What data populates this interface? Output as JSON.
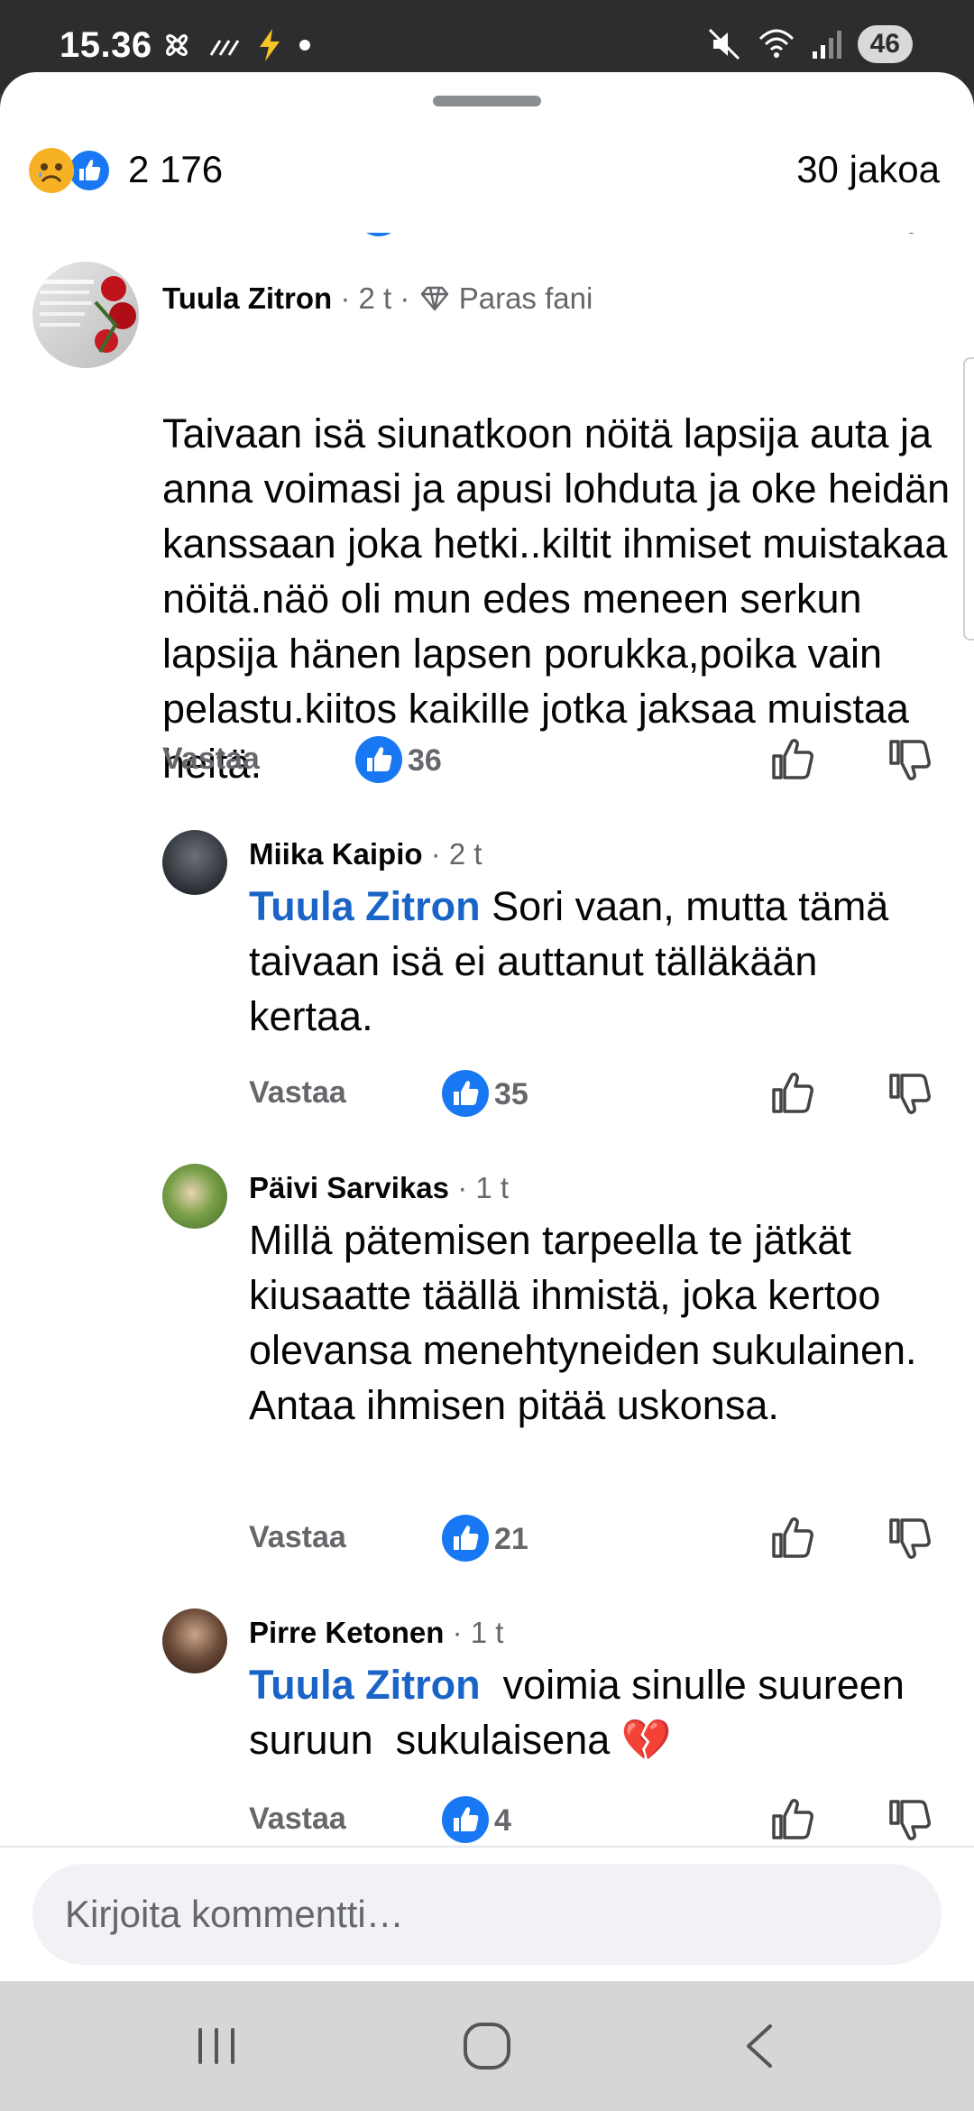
{
  "status_bar": {
    "time": "15.36",
    "battery": "46"
  },
  "reactions": {
    "count": "2 176",
    "shares": "30 jakoa"
  },
  "comments": [
    {
      "author": "Tuula Zitron",
      "time": "· 2 t ·",
      "badge": "Paras fani",
      "text": "Taivaan isä siunatkoon nöitä lapsija auta ja anna voimasi ja apusi lohduta ja oke heidän kanssaan joka hetki..kiltit ihmiset muistakaa nöitä.näö oli mun edes meneen serkun lapsija hänen lapsen porukka,poika vain pelastu.kiitos kaikille jotka jaksaa muistaa heitä.",
      "reply_label": "Vastaa",
      "likes": "36"
    },
    {
      "author": "Miika Kaipio",
      "time": "· 2 t",
      "mention": "Tuula Zitron",
      "text": " Sori vaan, mutta tämä taivaan isä ei auttanut tälläkään kertaa.",
      "reply_label": "Vastaa",
      "likes": "35"
    },
    {
      "author": "Päivi Sarvikas",
      "time": "· 1 t",
      "text": "Millä pätemisen tarpeella te jätkät kiusaatte täällä ihmistä, joka kertoo olevansa menehtyneiden sukulainen. Antaa ihmisen pitää uskonsa.",
      "reply_label": "Vastaa",
      "likes": "21"
    },
    {
      "author": "Pirre Ketonen",
      "time": "· 1 t",
      "mention": "Tuula Zitron",
      "text": "  voimia sinulle suureen suruun  sukulaisena 💔",
      "reply_label": "Vastaa",
      "likes": "4"
    }
  ],
  "composer": {
    "placeholder": "Kirjoita kommentti…"
  },
  "colors": {
    "like_blue": "#1877f2",
    "mention_blue": "#1a64c8",
    "secondary_text": "#65676b"
  }
}
